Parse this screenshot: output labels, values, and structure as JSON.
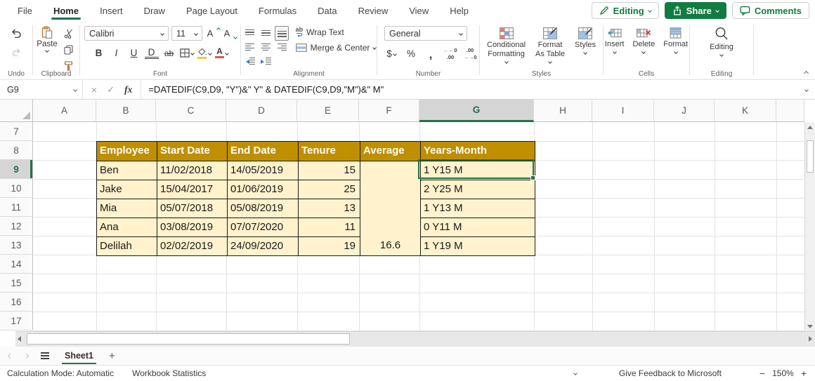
{
  "titlebar": {
    "tabs": [
      "File",
      "Home",
      "Insert",
      "Draw",
      "Page Layout",
      "Formulas",
      "Data",
      "Review",
      "View",
      "Help"
    ],
    "active_tab": "Home",
    "editing_button": "Editing",
    "share_button": "Share",
    "comments_button": "Comments"
  },
  "ribbon": {
    "undo": {
      "label": "Undo"
    },
    "clipboard": {
      "label": "Clipboard",
      "paste": "Paste"
    },
    "font": {
      "label": "Font",
      "family": "Calibri",
      "size": "11",
      "bold": "B",
      "italic": "I",
      "underline": "U",
      "double_underline": "D",
      "strikethrough": "ab",
      "grow": "A",
      "shrink": "A",
      "color_letter": "A"
    },
    "alignment": {
      "label": "Alignment",
      "wrap_text": "Wrap Text",
      "merge_center": "Merge & Center"
    },
    "number": {
      "label": "Number",
      "format": "General",
      "currency": "$",
      "percent": "%",
      "comma": ",",
      "inc_top": "←0",
      "inc_bottom": ".00",
      "dec_top": ".00",
      "dec_bottom": "→0"
    },
    "styles": {
      "label": "Styles",
      "conditional_formatting": "Conditional Formatting",
      "format_as_table": "Format As Table",
      "styles_button": "Styles"
    },
    "cells": {
      "label": "Cells",
      "insert": "Insert",
      "delete": "Delete",
      "format": "Format"
    },
    "editing": {
      "label": "Editing"
    }
  },
  "formula_bar": {
    "name_box": "G9",
    "fx": "fx",
    "formula": "=DATEDIF(C9,D9, \"Y\")&\" Y\" & DATEDIF(C9,D9,\"M\")&\" M\""
  },
  "grid": {
    "columns": [
      "A",
      "B",
      "C",
      "D",
      "E",
      "F",
      "G",
      "H",
      "I",
      "J",
      "K"
    ],
    "selected_column": "G",
    "row_start": 7,
    "row_end": 17,
    "selected_row": 9,
    "selected_cell": "G9",
    "table": {
      "headers": [
        "Employee",
        "Start Date",
        "End Date",
        "Tenure",
        "Average",
        "Years-Month"
      ],
      "rows": [
        {
          "employee": "Ben",
          "start_date": "11/02/2018",
          "end_date": "14/05/2019",
          "tenure": "15",
          "years_month": "1 Y15 M"
        },
        {
          "employee": "Jake",
          "start_date": "15/04/2017",
          "end_date": "01/06/2019",
          "tenure": "25",
          "years_month": "2 Y25 M"
        },
        {
          "employee": "Mia",
          "start_date": "05/07/2018",
          "end_date": "05/08/2019",
          "tenure": "13",
          "years_month": "1 Y13 M"
        },
        {
          "employee": "Ana",
          "start_date": "03/08/2019",
          "end_date": "07/07/2020",
          "tenure": "11",
          "years_month": "0 Y11 M"
        },
        {
          "employee": "Delilah",
          "start_date": "02/02/2019",
          "end_date": "24/09/2020",
          "tenure": "19",
          "years_month": "1 Y19 M"
        }
      ],
      "average": "16.6",
      "header_bg": "#BF8F00",
      "body_bg": "#FFF2CC"
    }
  },
  "sheet_bar": {
    "sheet_name": "Sheet1",
    "add_sheet": "+"
  },
  "status_bar": {
    "calculation_mode": "Calculation Mode: Automatic",
    "workbook_statistics": "Workbook Statistics",
    "feedback": "Give Feedback to Microsoft",
    "zoom_out": "−",
    "zoom_level": "150%",
    "zoom_in": "+"
  },
  "colors": {
    "accent_green": "#107C41",
    "selection_green": "#217346",
    "table_header_bg": "#BF8F00",
    "table_body_bg": "#FFF2CC"
  }
}
